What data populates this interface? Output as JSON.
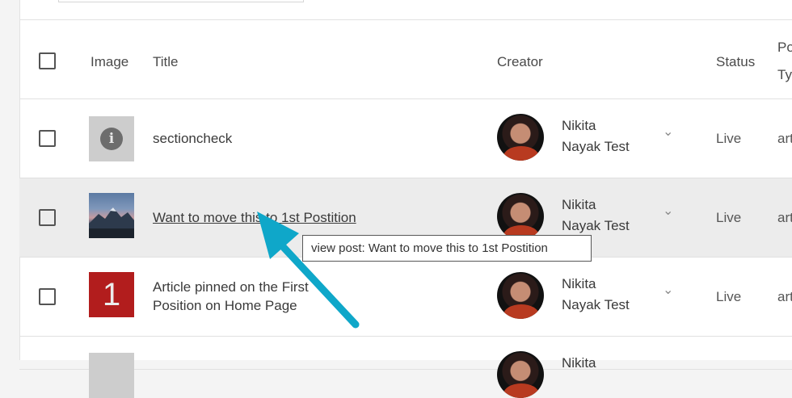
{
  "table": {
    "headers": {
      "image": "Image",
      "title": "Title",
      "creator": "Creator",
      "status": "Status",
      "post_type_line1": "Po",
      "post_type_line2": "Ty"
    },
    "rows": [
      {
        "title": "sectioncheck",
        "creator_line1": "Nikita",
        "creator_line2": "Nayak Test",
        "status": "Live",
        "post_type": "art",
        "thumb_icon": "info-icon"
      },
      {
        "title": "Want to move this to 1st Postition",
        "creator_line1": "Nikita",
        "creator_line2": "Nayak Test",
        "status": "Live",
        "post_type": "art",
        "thumb_icon": "mountain-photo"
      },
      {
        "title_line1": "Article pinned on the First",
        "title_line2": "Position on Home Page",
        "thumb_text": "1",
        "creator_line1": "Nikita",
        "creator_line2": "Nayak Test",
        "status": "Live",
        "post_type": "art"
      },
      {
        "creator_line1": "Nikita"
      }
    ]
  },
  "tooltip": {
    "text": "view post: Want to move this to 1st Postition"
  },
  "glyphs": {
    "info": "i",
    "chevron": "⌄"
  },
  "colors": {
    "arrow": "#0fa7c9",
    "row_highlight": "#ececec",
    "thumb_red": "#b21d1d"
  }
}
